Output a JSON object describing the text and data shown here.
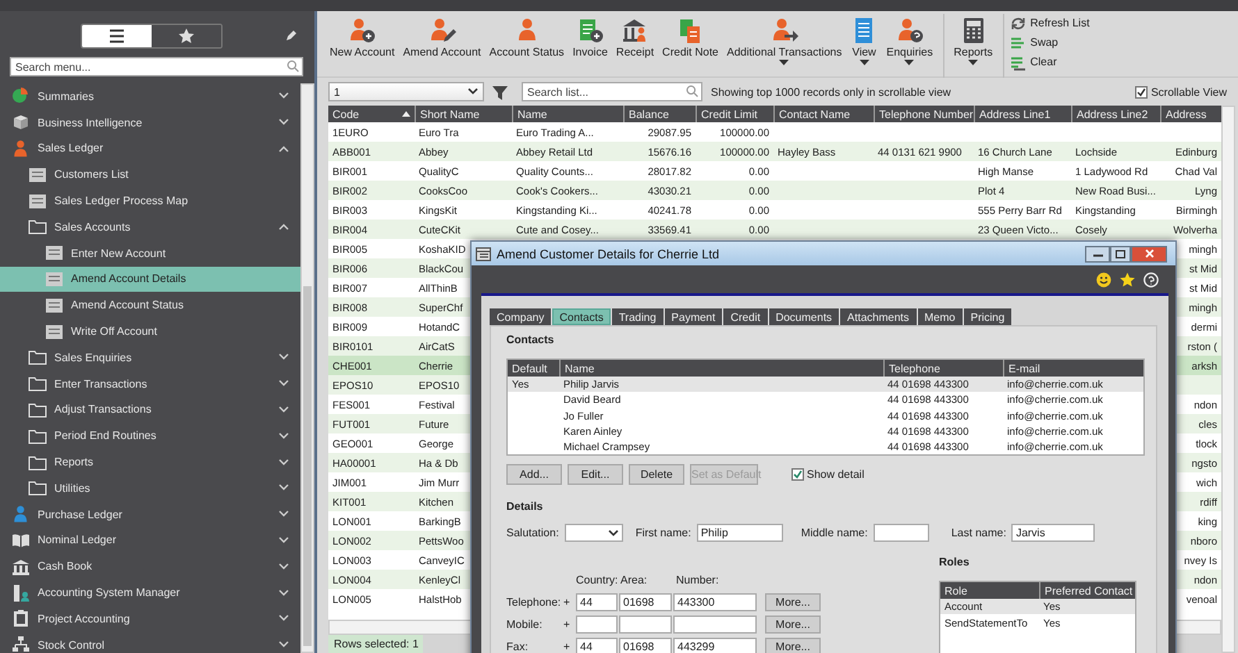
{
  "sidebar": {
    "view_toggle": [
      {
        "selected": true
      },
      {
        "selected": false
      }
    ],
    "search": {
      "placeholder": "Search menu..."
    },
    "items": [
      {
        "label": "Summaries",
        "selected": false,
        "expanded": false
      },
      {
        "label": "Business Intelligence",
        "selected": false,
        "expanded": false
      },
      {
        "label": "Sales Ledger",
        "selected": false,
        "expanded": true,
        "children": [
          {
            "label": "Customers List",
            "selected": false
          },
          {
            "label": "Sales Ledger Process Map",
            "selected": false
          },
          {
            "label": "Sales Accounts",
            "selected": false,
            "expanded": true,
            "children": [
              {
                "label": "Enter New Account",
                "selected": false
              },
              {
                "label": "Amend Account Details",
                "selected": true
              },
              {
                "label": "Amend Account Status",
                "selected": false
              },
              {
                "label": "Write Off Account",
                "selected": false
              }
            ]
          },
          {
            "label": "Sales Enquiries",
            "selected": false,
            "expanded": false
          },
          {
            "label": "Enter Transactions",
            "selected": false,
            "expanded": false
          },
          {
            "label": "Adjust Transactions",
            "selected": false,
            "expanded": false
          },
          {
            "label": "Period End Routines",
            "selected": false,
            "expanded": false
          },
          {
            "label": "Reports",
            "selected": false,
            "expanded": false
          },
          {
            "label": "Utilities",
            "selected": false,
            "expanded": false
          }
        ]
      },
      {
        "label": "Purchase Ledger",
        "selected": false,
        "expanded": false
      },
      {
        "label": "Nominal Ledger",
        "selected": false,
        "expanded": false
      },
      {
        "label": "Cash Book",
        "selected": false,
        "expanded": false
      },
      {
        "label": "Accounting System Manager",
        "selected": false,
        "expanded": false
      },
      {
        "label": "Project Accounting",
        "selected": false,
        "expanded": false
      },
      {
        "label": "Stock Control",
        "selected": false,
        "expanded": false
      }
    ]
  },
  "toolbar": {
    "groups": [
      [
        {
          "label": "New Account",
          "has_menu": false
        },
        {
          "label": "Amend Account",
          "has_menu": false
        },
        {
          "label": "Account Status",
          "has_menu": false
        },
        {
          "label": "Invoice",
          "has_menu": false
        },
        {
          "label": "Receipt",
          "has_menu": false
        },
        {
          "label": "Credit Note",
          "has_menu": false
        },
        {
          "label": "Additional Transactions",
          "has_menu": true
        },
        {
          "label": "View",
          "has_menu": true
        },
        {
          "label": "Enquiries",
          "has_menu": true
        }
      ],
      [
        {
          "label": "Reports",
          "has_menu": true
        }
      ]
    ],
    "actions": [
      "Refresh List",
      "Swap",
      "Clear"
    ]
  },
  "filter": {
    "records": "1",
    "search_placeholder": "Search list...",
    "info": "Showing top 1000 records only in scrollable view",
    "scrollable_view": {
      "label": "Scrollable View",
      "checked": true
    }
  },
  "table": {
    "columns": [
      {
        "label": "Code",
        "sorted": true
      },
      {
        "label": "Short Name",
        "sorted": false
      },
      {
        "label": "Name",
        "sorted": false
      },
      {
        "label": "Balance",
        "sorted": false
      },
      {
        "label": "Credit Limit",
        "sorted": false
      },
      {
        "label": "Contact Name",
        "sorted": false
      },
      {
        "label": "Telephone Number",
        "sorted": false
      },
      {
        "label": "Address Line1",
        "sorted": false
      },
      {
        "label": "Address Line2",
        "sorted": false
      },
      {
        "label": "Address",
        "sorted": false
      }
    ],
    "rows": [
      {
        "cells": [
          "1EURO",
          "Euro Tra",
          "Euro Trading A...",
          "29087.95",
          "100000.00",
          null,
          null,
          null,
          null,
          null
        ],
        "selected": false
      },
      {
        "cells": [
          "ABB001",
          "Abbey",
          "Abbey Retail Ltd",
          "15676.16",
          "100000.00",
          "Hayley Bass",
          "44 0131 621 9900",
          "16 Church Lane",
          "Lochside",
          "Edinburg"
        ],
        "selected": false
      },
      {
        "cells": [
          "BIR001",
          "QualityC",
          "Quality Counts...",
          "28017.82",
          "0.00",
          null,
          null,
          "High Manse",
          "1 Ladywood Rd",
          "Chad Val"
        ],
        "selected": false
      },
      {
        "cells": [
          "BIR002",
          "CooksCoo",
          "Cook's Cookers...",
          "43030.21",
          "0.00",
          null,
          null,
          "Plot 4",
          "New Road Busi...",
          "Lyng"
        ],
        "selected": false
      },
      {
        "cells": [
          "BIR003",
          "KingsKit",
          "Kingstanding Ki...",
          "40241.78",
          "0.00",
          null,
          null,
          "555 Perry Barr Rd",
          "Kingstanding",
          "Birmingh"
        ],
        "selected": false
      },
      {
        "cells": [
          "BIR004",
          "CuteCKit",
          "Cute and Cosey...",
          "33569.41",
          "0.00",
          null,
          null,
          "23 Queen Victo...",
          "Cosely",
          "Wolverha"
        ],
        "selected": false
      },
      {
        "cells": [
          "BIR005",
          "KoshaKID",
          null,
          null,
          null,
          null,
          null,
          null,
          null,
          "mingh"
        ],
        "selected": false
      },
      {
        "cells": [
          "BIR006",
          "BlackCou",
          null,
          null,
          null,
          null,
          null,
          null,
          null,
          "st Mid"
        ],
        "selected": false
      },
      {
        "cells": [
          "BIR007",
          "AllThinB",
          null,
          null,
          null,
          null,
          null,
          null,
          null,
          "st Mid"
        ],
        "selected": false
      },
      {
        "cells": [
          "BIR008",
          "SuperChf",
          null,
          null,
          null,
          null,
          null,
          null,
          null,
          "mingh"
        ],
        "selected": false
      },
      {
        "cells": [
          "BIR009",
          "HotandC",
          null,
          null,
          null,
          null,
          null,
          null,
          null,
          "dermi"
        ],
        "selected": false
      },
      {
        "cells": [
          "BIR0101",
          "AirCatS",
          null,
          null,
          null,
          null,
          null,
          null,
          null,
          "rston ("
        ],
        "selected": false
      },
      {
        "cells": [
          "CHE001",
          "Cherrie",
          null,
          null,
          null,
          null,
          null,
          null,
          null,
          "arksh"
        ],
        "selected": true
      },
      {
        "cells": [
          "EPOS10",
          "EPOS10",
          null,
          null,
          null,
          null,
          null,
          null,
          null,
          null
        ],
        "selected": false
      },
      {
        "cells": [
          "FES001",
          "Festival",
          null,
          null,
          null,
          null,
          null,
          null,
          null,
          "ndon"
        ],
        "selected": false
      },
      {
        "cells": [
          "FUT001",
          "Future",
          null,
          null,
          null,
          null,
          null,
          null,
          null,
          "cles"
        ],
        "selected": false
      },
      {
        "cells": [
          "GEO001",
          "George",
          null,
          null,
          null,
          null,
          null,
          null,
          null,
          "tlock"
        ],
        "selected": false
      },
      {
        "cells": [
          "HA00001",
          "Ha & Db",
          null,
          null,
          null,
          null,
          null,
          null,
          null,
          "ngsto"
        ],
        "selected": false
      },
      {
        "cells": [
          "JIM001",
          "Jim Murr",
          null,
          null,
          null,
          null,
          null,
          null,
          null,
          "wich"
        ],
        "selected": false
      },
      {
        "cells": [
          "KIT001",
          "Kitchen",
          null,
          null,
          null,
          null,
          null,
          null,
          null,
          "rdiff"
        ],
        "selected": false
      },
      {
        "cells": [
          "LON001",
          "BarkingB",
          null,
          null,
          null,
          null,
          null,
          null,
          null,
          "king"
        ],
        "selected": false
      },
      {
        "cells": [
          "LON002",
          "PettsWoo",
          null,
          null,
          null,
          null,
          null,
          null,
          null,
          "nboro"
        ],
        "selected": false
      },
      {
        "cells": [
          "LON003",
          "CanveyIC",
          null,
          null,
          null,
          null,
          null,
          null,
          null,
          "nvey Is"
        ],
        "selected": false
      },
      {
        "cells": [
          "LON004",
          "KenleyCl",
          null,
          null,
          null,
          null,
          null,
          null,
          null,
          "ndon"
        ],
        "selected": false
      },
      {
        "cells": [
          "LON005",
          "HalstHob",
          null,
          null,
          null,
          null,
          null,
          null,
          null,
          "venoal"
        ],
        "selected": false
      }
    ],
    "status": "Rows selected: 1"
  },
  "dialog": {
    "title": "Amend Customer Details for Cherrie Ltd",
    "tabs": [
      {
        "label": "Company",
        "selected": false
      },
      {
        "label": "Contacts",
        "selected": true
      },
      {
        "label": "Trading",
        "selected": false
      },
      {
        "label": "Payment",
        "selected": false
      },
      {
        "label": "Credit",
        "selected": false
      },
      {
        "label": "Documents",
        "selected": false
      },
      {
        "label": "Attachments",
        "selected": false
      },
      {
        "label": "Memo",
        "selected": false
      },
      {
        "label": "Pricing",
        "selected": false
      }
    ],
    "contacts": {
      "heading": "Contacts",
      "columns": [
        "Default",
        "Name",
        "Telephone",
        "E-mail"
      ],
      "rows": [
        {
          "cells": [
            "Yes",
            "Philip Jarvis",
            "44 01698 443300",
            "info@cherrie.com.uk"
          ],
          "selected": true
        },
        {
          "cells": [
            "",
            "David Beard",
            "44 01698 443300",
            "info@cherrie.com.uk"
          ],
          "selected": false
        },
        {
          "cells": [
            "",
            "Jo Fuller",
            "44 01698 443300",
            "info@cherrie.com.uk"
          ],
          "selected": false
        },
        {
          "cells": [
            "",
            "Karen Ainley",
            "44 01698 443300",
            "info@cherrie.com.uk"
          ],
          "selected": false
        },
        {
          "cells": [
            "",
            "Michael Crampsey",
            "44 01698 443300",
            "info@cherrie.com.uk"
          ],
          "selected": false
        }
      ]
    },
    "buttons": [
      {
        "label": "Add...",
        "disabled": false
      },
      {
        "label": "Edit...",
        "disabled": false
      },
      {
        "label": "Delete",
        "disabled": false
      },
      {
        "label": "Set as Default",
        "disabled": true
      }
    ],
    "show_detail": {
      "label": "Show detail",
      "checked": true
    },
    "details": {
      "heading": "Details",
      "fields": [
        {
          "label": "Salutation:",
          "kind": "select"
        },
        {
          "label": "First name:",
          "kind": "text",
          "value": "Philip"
        },
        {
          "label": "Middle name:",
          "kind": "text"
        },
        {
          "label": "Last name:",
          "kind": "text",
          "value": "Jarvis"
        }
      ]
    },
    "phone": {
      "columns": [
        "Country:",
        "Area:",
        "Number:"
      ],
      "rows": [
        {
          "label": "Telephone:",
          "prefix": "+",
          "values": [
            "44",
            "01698",
            "443300"
          ],
          "button": "More..."
        },
        {
          "label": "Mobile:",
          "prefix": "+",
          "values": [],
          "button": "More..."
        },
        {
          "label": "Fax:",
          "prefix": "+",
          "values": [
            "44",
            "01698",
            "443299"
          ],
          "button": "More..."
        }
      ]
    },
    "roles": {
      "heading": "Roles",
      "columns": [
        "Role",
        "Preferred Contact"
      ],
      "rows": [
        {
          "cells": [
            "Account",
            "Yes"
          ],
          "selected": true
        },
        {
          "cells": [
            "SendStatementTo",
            "Yes"
          ],
          "selected": false
        }
      ]
    }
  }
}
